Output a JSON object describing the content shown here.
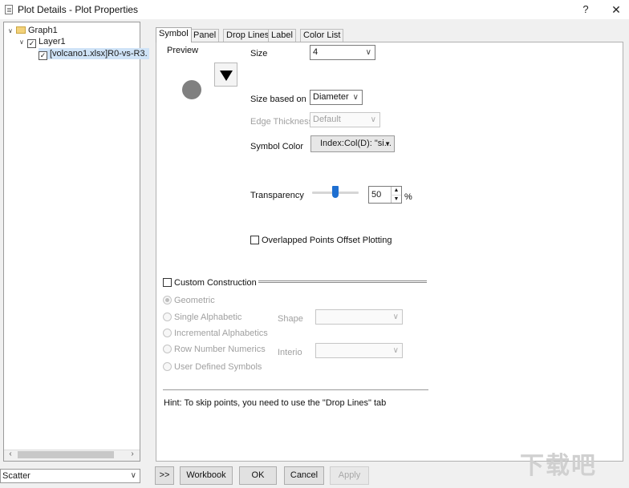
{
  "window": {
    "title": "Plot Details - Plot Properties",
    "help_label": "?",
    "close_label": "✕"
  },
  "tree": {
    "graph": "Graph1",
    "layer": "Layer1",
    "plot": "[volcano1.xlsx]R0-vs-R3."
  },
  "tabs": [
    "Symbol",
    "Panel",
    "Drop Lines",
    "Label",
    "Color List"
  ],
  "symbol": {
    "preview_label": "Preview",
    "size_label": "Size",
    "size_value": "4",
    "size_based_on_label": "Size based on",
    "size_based_on_value": "Diameter",
    "edge_thickness_label": "Edge Thickness",
    "edge_thickness_value": "Default",
    "symbol_color_label": "Symbol Color",
    "symbol_color_value": "Index:Col(D): \"si...",
    "transparency_label": "Transparency",
    "transparency_value": "50",
    "transparency_level": 0.5,
    "percent": "%",
    "overlapped_label": "Overlapped Points Offset Plotting",
    "custom_construction_label": "Custom Construction",
    "radio_options": [
      "Geometric",
      "Single Alphabetic",
      "Incremental Alphabetics",
      "Row Number Numerics",
      "User Defined Symbols"
    ],
    "shape_label": "Shape",
    "interior_label": "Interio",
    "hint": "Hint: To skip points, you need to use the \"Drop Lines\" tab"
  },
  "bottom": {
    "plot_type": "Scatter",
    "toggle_label": ">>",
    "workbook_label": "Workbook",
    "ok_label": "OK",
    "cancel_label": "Cancel",
    "apply_label": "Apply"
  },
  "watermark": {
    "text": "下载吧"
  },
  "colors": {
    "preview_circle": "#808080",
    "slider_thumb": "#1e6fd1",
    "selection": "#cfe3f7"
  }
}
